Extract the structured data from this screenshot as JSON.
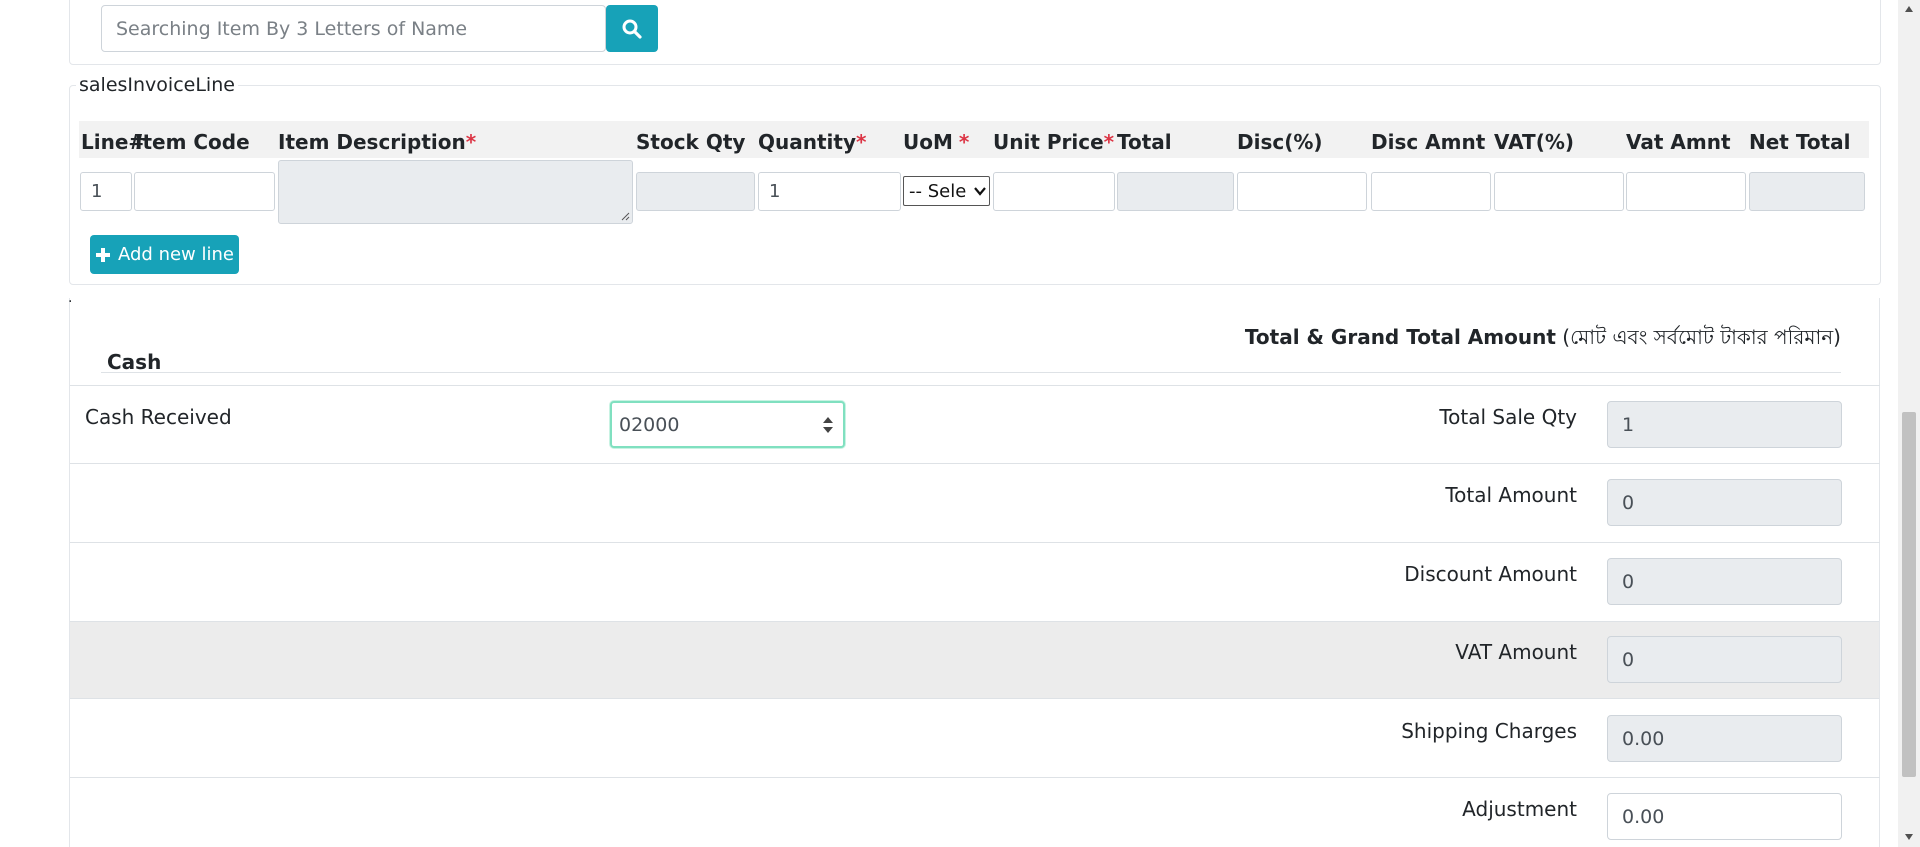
{
  "search": {
    "placeholder": "Searching Item By 3 Letters of Name"
  },
  "sales_invoice_line": {
    "legend": "salesInvoiceLine",
    "columns": [
      {
        "label": "Line#",
        "required": false
      },
      {
        "label": "Item Code",
        "required": false
      },
      {
        "label": "Item Description",
        "required": true
      },
      {
        "label": "Stock Qty",
        "required": false
      },
      {
        "label": "Quantity",
        "required": true
      },
      {
        "label": "UoM",
        "required": true
      },
      {
        "label": "Unit Price",
        "required": true
      },
      {
        "label": "Total",
        "required": false
      },
      {
        "label": "Disc(%)",
        "required": false
      },
      {
        "label": "Disc Amnt",
        "required": false
      },
      {
        "label": "VAT(%)",
        "required": false
      },
      {
        "label": "Vat Amnt",
        "required": false
      },
      {
        "label": "Net Total",
        "required": false
      }
    ],
    "required_mark": "*",
    "row": {
      "line": "1",
      "item_code": "",
      "item_description": "",
      "stock_qty": "",
      "quantity": "1",
      "uom": "-- Sele",
      "unit_price": "",
      "total": "",
      "disc_pct": "",
      "disc_amnt": "",
      "vat_pct": "",
      "vat_amnt": "",
      "net_total": ""
    },
    "add_line_label": "Add new line"
  },
  "totals_section": {
    "dot": ".",
    "title_bold": "Total & Grand Total Amount",
    "title_bangla": "(মোট এবং সর্বমোট টাকার পরিমান)",
    "cash_heading": "Cash",
    "cash_received_label": "Cash Received",
    "cash_received_value": "02000",
    "fields": [
      {
        "label": "Total Sale Qty",
        "value": "1",
        "readonly": true
      },
      {
        "label": "Total Amount",
        "value": "0",
        "readonly": true
      },
      {
        "label": "Discount Amount",
        "value": "0",
        "readonly": true
      },
      {
        "label": "VAT Amount",
        "value": "0",
        "readonly": true
      },
      {
        "label": "Shipping Charges",
        "value": "0.00",
        "readonly": true
      },
      {
        "label": "Adjustment",
        "value": "0.00",
        "readonly": false
      }
    ]
  },
  "colors": {
    "accent": "#17a2b8",
    "required": "#dc3545",
    "readonly_bg": "#e9ecef",
    "highlight_row": "#ececec",
    "focus_border": "#80e0c0"
  },
  "icons": {
    "search": "search-icon",
    "add": "plus-icon",
    "spinner": "number-spinner-icon",
    "select": "chevron-down-icon"
  }
}
